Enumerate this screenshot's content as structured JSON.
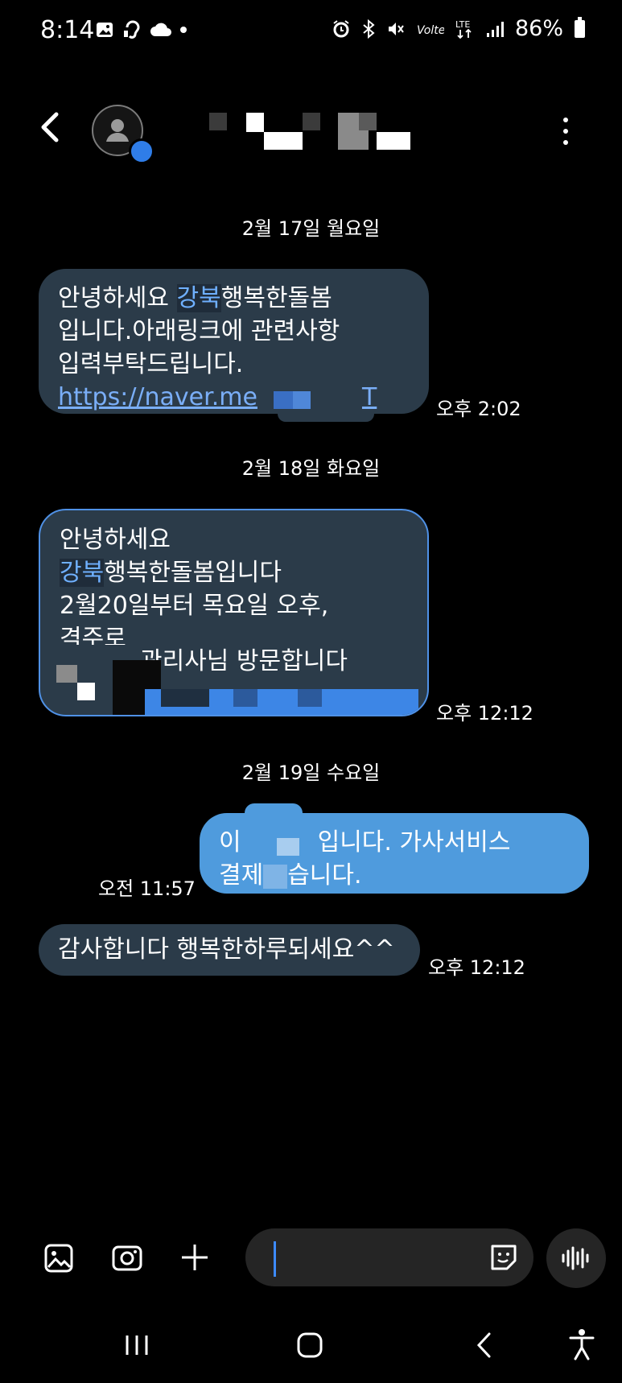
{
  "status_bar": {
    "time": "8:14",
    "battery": "86%",
    "icons_left": [
      "gallery-icon",
      "hearing-icon",
      "cloud-icon"
    ],
    "icons_right": [
      "alarm-icon",
      "bluetooth-icon",
      "mute-icon",
      "volte-icon",
      "lte-icon",
      "signal-icon",
      "battery-icon"
    ]
  },
  "header": {
    "contact_name": ""
  },
  "messages": [
    {
      "date": "2월 17일 월요일",
      "direction": "incoming",
      "line1_a": "안녕하세요 ",
      "line1_highlight": "강북",
      "line1_b": "행복한돌봄",
      "line2": "입니다.아래링크에 관련사항",
      "line3": "입력부탁드립니다.",
      "link": "https://naver.me",
      "link_tail": "T",
      "time": "오후 2:02"
    },
    {
      "date": "2월 18일 화요일",
      "direction": "incoming",
      "line1": "안녕하세요",
      "line2_highlight": "강북",
      "line2_b": "행복한돌봄입니다",
      "line3": "2월20일부터 목요일 오후,",
      "line4": "격주로",
      "line5": "관리사님 방문합니다",
      "time": "오후 12:12"
    },
    {
      "date": "2월 19일 수요일",
      "direction": "outgoing",
      "line1_a": "이",
      "line1_b": "입니다. 가사서비스",
      "line2_a": "결제",
      "line2_b": "습니다.",
      "time": "오전 11:57"
    },
    {
      "direction": "incoming",
      "text": "감사합니다 행복한하루되세요^^",
      "time": "오후 12:12"
    }
  ],
  "composer": {
    "placeholder": ""
  },
  "colors": {
    "incoming_bubble": "#2b3b49",
    "outgoing_bubble": "#4f9bdd",
    "accent": "#2f7de8",
    "highlight_text": "#6fb0ff"
  }
}
